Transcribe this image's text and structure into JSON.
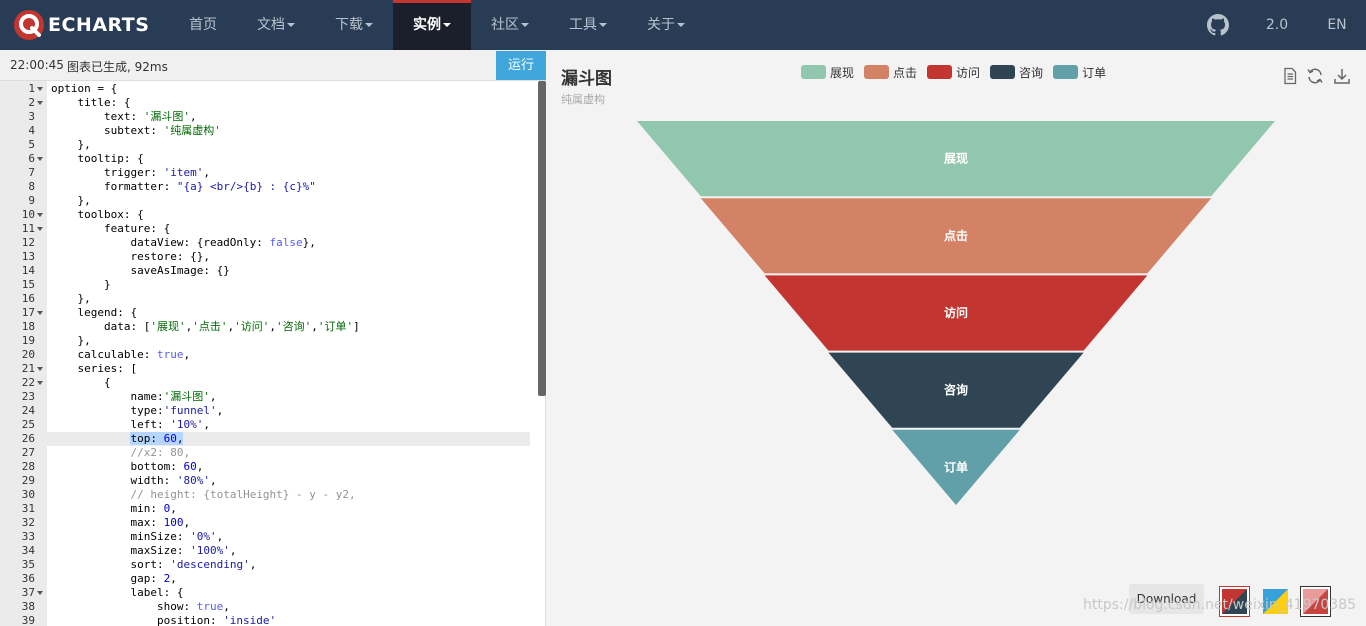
{
  "nav": {
    "logo_text": "ECHARTS",
    "items": [
      {
        "label": "首页",
        "dropdown": false
      },
      {
        "label": "文档",
        "dropdown": true
      },
      {
        "label": "下载",
        "dropdown": true
      },
      {
        "label": "实例",
        "dropdown": true,
        "active": true
      },
      {
        "label": "社区",
        "dropdown": true
      },
      {
        "label": "工具",
        "dropdown": true
      },
      {
        "label": "关于",
        "dropdown": true
      }
    ],
    "version": "2.0",
    "lang": "EN"
  },
  "status": {
    "time": "22:00:45",
    "message": "图表已生成, 92ms",
    "run_label": "运行"
  },
  "code_lines": [
    "option = {",
    "    title: {",
    "        text: '漏斗图',",
    "        subtext: '纯属虚构'",
    "    },",
    "    tooltip: {",
    "        trigger: 'item',",
    "        formatter: \"{a} <br/>{b} : {c}%\"",
    "    },",
    "    toolbox: {",
    "        feature: {",
    "            dataView: {readOnly: false},",
    "            restore: {},",
    "            saveAsImage: {}",
    "        }",
    "    },",
    "    legend: {",
    "        data: ['展现','点击','访问','咨询','订单']",
    "    },",
    "    calculable: true,",
    "    series: [",
    "        {",
    "            name:'漏斗图',",
    "            type:'funnel',",
    "            left: '10%',",
    "            top: 60,",
    "            //x2: 80,",
    "            bottom: 60,",
    "            width: '80%',",
    "            // height: {totalHeight} - y - y2,",
    "            min: 0,",
    "            max: 100,",
    "            minSize: '0%',",
    "            maxSize: '100%',",
    "            sort: 'descending',",
    "            gap: 2,",
    "            label: {",
    "                show: true,",
    "                position: 'inside'"
  ],
  "fold_lines": [
    1,
    2,
    6,
    10,
    11,
    17,
    21,
    22,
    37
  ],
  "current_line": 26,
  "chart": {
    "title": "漏斗图",
    "subtitle": "纯属虚构",
    "download_label": "Download",
    "watermark": "https://blog.csdn.net/weixin_41970385",
    "toolbox_icons": [
      "data-view-icon",
      "restore-icon",
      "save-as-image-icon"
    ]
  },
  "chart_data": {
    "type": "funnel",
    "title": "漏斗图",
    "subtitle": "纯属虚构",
    "legend_position": "top-center",
    "categories": [
      "展现",
      "点击",
      "访问",
      "咨询",
      "订单"
    ],
    "values": [
      100,
      80,
      60,
      40,
      20
    ],
    "colors": [
      "#91c7ae",
      "#d48265",
      "#c23531",
      "#2f4554",
      "#61a0a8"
    ],
    "min": 0,
    "max": 100,
    "sort": "descending",
    "gap": 2,
    "label_position": "inside"
  },
  "theme_colors": {
    "navbar": "#293c55",
    "accent": "#c23531",
    "run_button": "#3fa7dc"
  }
}
